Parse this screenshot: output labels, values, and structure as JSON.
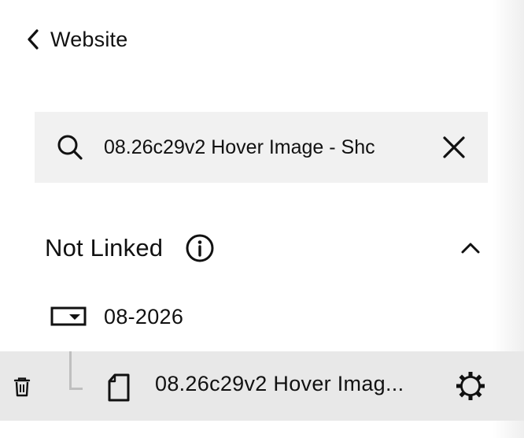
{
  "nav": {
    "back_label": "Website"
  },
  "search": {
    "value": "08.26c29v2 Hover Image - Shc",
    "placeholder": ""
  },
  "section": {
    "title": "Not Linked"
  },
  "folder": {
    "label": "08-2026"
  },
  "page": {
    "label": "08.26c29v2 Hover Imag..."
  },
  "icons": {
    "back": "chevron-left-icon",
    "search": "search-icon",
    "clear": "close-icon",
    "info": "info-icon",
    "collapse": "chevron-up-icon",
    "folder": "folder-icon",
    "trash": "trash-icon",
    "page": "page-icon",
    "settings": "gear-icon"
  },
  "colors": {
    "text": "#111111",
    "search_bg": "#f1f1f1",
    "selected_row_bg": "#e8e8e8",
    "tree_line": "#bfbfbf"
  }
}
